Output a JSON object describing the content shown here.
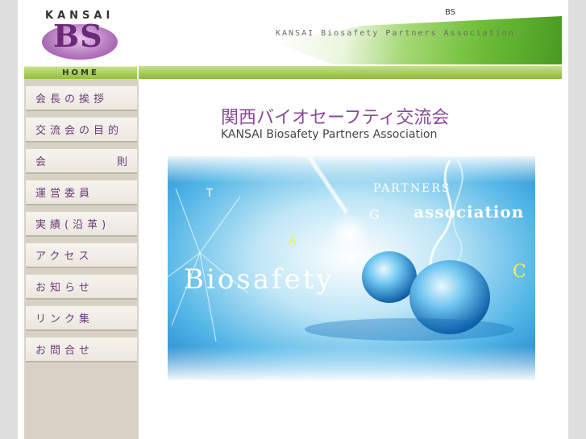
{
  "header": {
    "logo_kansai": "KANSAI",
    "logo_bs": "BS",
    "small_bs": "BS",
    "caption": "KANSAI Biosafety Partners Association"
  },
  "home_label": "HOME",
  "sidebar": {
    "items": [
      {
        "label": "会長の挨拶"
      },
      {
        "label": "交流会の目的"
      },
      {
        "label": "会 則",
        "left": "会",
        "right": "則"
      },
      {
        "label": "運営委員"
      },
      {
        "label": "実績(沿革)"
      },
      {
        "label": "アクセス"
      },
      {
        "label": "お知らせ"
      },
      {
        "label": "リンク集"
      },
      {
        "label": "お問合せ"
      }
    ]
  },
  "main": {
    "title_jp": "関西バイオセーフティ交流会",
    "title_en": "KANSAI Biosafety Partners Association"
  },
  "hero": {
    "text_biosafety": "Biosafety",
    "text_partners": "PARTNERS",
    "text_association": "association",
    "letters": [
      "T",
      "G",
      "A",
      "C"
    ]
  }
}
